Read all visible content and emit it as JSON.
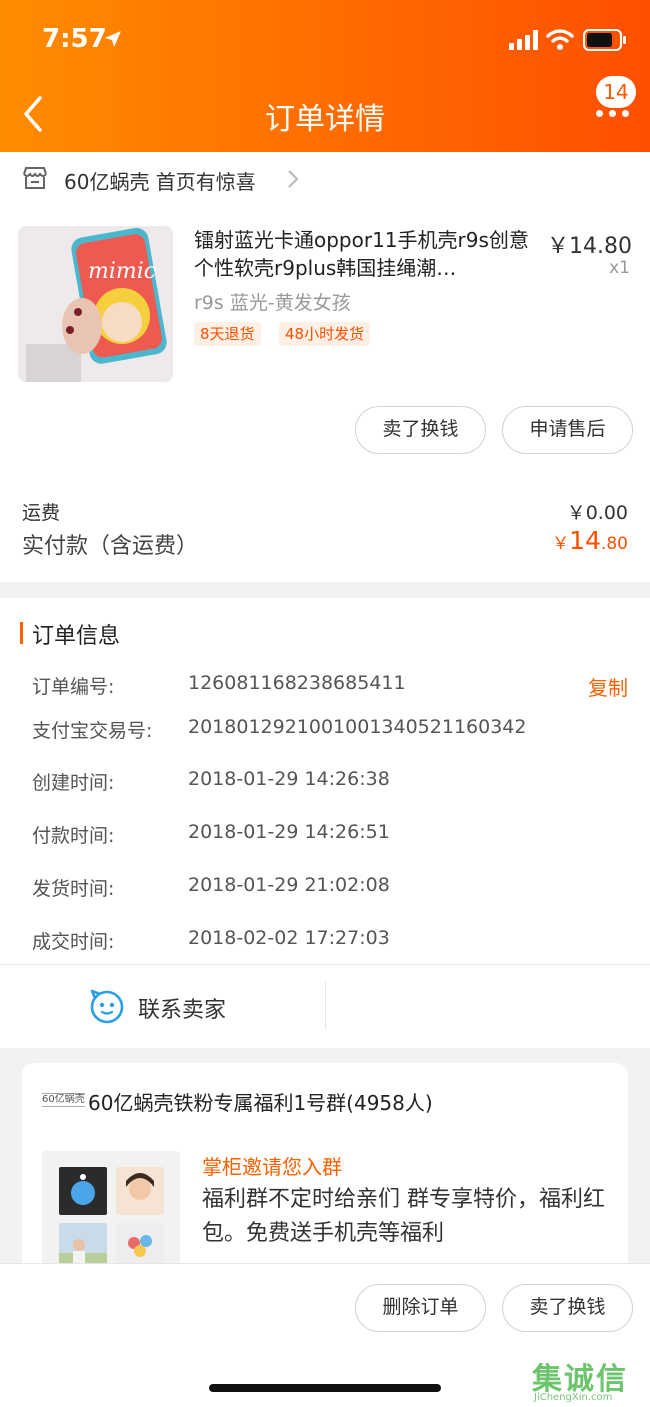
{
  "status_bar": {
    "time": "7:57"
  },
  "nav": {
    "title": "订单详情",
    "badge_count": "14",
    "accent": "#ff6a00"
  },
  "shop": {
    "name": "60亿蜗壳 首页有惊喜"
  },
  "item": {
    "title": "镭射蓝光卡通oppor11手机壳r9s创意个性软壳r9plus韩国挂绳潮…",
    "price": "￥14.80",
    "quantity": "x1",
    "sku": "r9s 蓝光-黄发女孩",
    "tags": [
      "8天退货",
      "48小时发货"
    ],
    "thumb_text": "mimic"
  },
  "item_actions": {
    "sell": "卖了换钱",
    "after_sale": "申请售后"
  },
  "payment": {
    "shipping_label": "运费",
    "shipping_value": "￥0.00",
    "paid_label": "实付款（含运费）",
    "paid_currency": "￥",
    "paid_int": "14",
    "paid_dec": ".80"
  },
  "order_info": {
    "section_title": "订单信息",
    "copy_label": "复制",
    "rows": [
      {
        "label": "订单编号:",
        "value": "126081168238685411"
      },
      {
        "label": "支付宝交易号:",
        "value": "2018012921001001340521160342"
      },
      {
        "label": "创建时间:",
        "value": "2018-01-29 14:26:38"
      },
      {
        "label": "付款时间:",
        "value": "2018-01-29 14:26:51"
      },
      {
        "label": "发货时间:",
        "value": "2018-01-29 21:02:08"
      },
      {
        "label": "成交时间:",
        "value": "2018-02-02 17:27:03"
      }
    ],
    "contact_seller": "联系卖家"
  },
  "group": {
    "logo_text": "60亿蜗壳",
    "name": "60亿蜗壳铁粉专属福利1号群(4958人)",
    "invite": "掌柜邀请您入群",
    "desc": "福利群不定时给亲们 群专享特价，福利红包。免费送手机壳等福利"
  },
  "bottom_actions": {
    "delete_order": "删除订单",
    "sell": "卖了换钱"
  },
  "watermark": {
    "brand": "集诚信",
    "url": "JiChengXin.com"
  }
}
